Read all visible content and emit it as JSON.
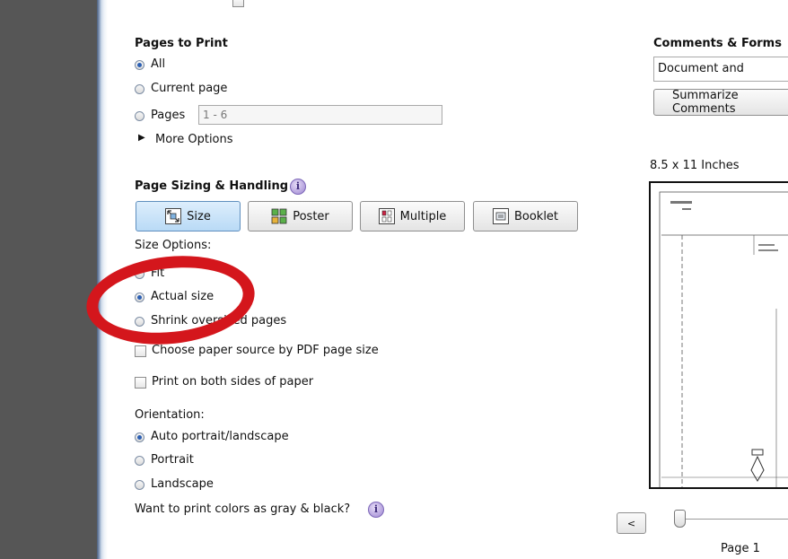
{
  "pages_to_print": {
    "heading": "Pages to Print",
    "all": "All",
    "current": "Current page",
    "pages": "Pages",
    "pages_value": "1 - 6",
    "more_options": "More Options"
  },
  "sizing": {
    "heading": "Page Sizing & Handling",
    "buttons": {
      "size": "Size",
      "poster": "Poster",
      "multiple": "Multiple",
      "booklet": "Booklet"
    },
    "options_label": "Size Options:",
    "fit": "Fit",
    "actual": "Actual size",
    "shrink": "Shrink oversized pages",
    "paper_source": "Choose paper source by PDF page size",
    "both_sides": "Print on both sides of paper"
  },
  "orientation": {
    "label": "Orientation:",
    "auto": "Auto portrait/landscape",
    "portrait": "Portrait",
    "landscape": "Landscape"
  },
  "gray_question": "Want to print colors as gray & black?",
  "comments": {
    "heading": "Comments & Forms",
    "select_value": "Document and Markups",
    "summarize": "Summarize Comments"
  },
  "preview": {
    "size_label": "8.5 x 11 Inches",
    "page_label": "Page 1",
    "prev": "<"
  },
  "colors": {
    "accent_red": "#d4161c",
    "active_button": "#b9daf6"
  }
}
